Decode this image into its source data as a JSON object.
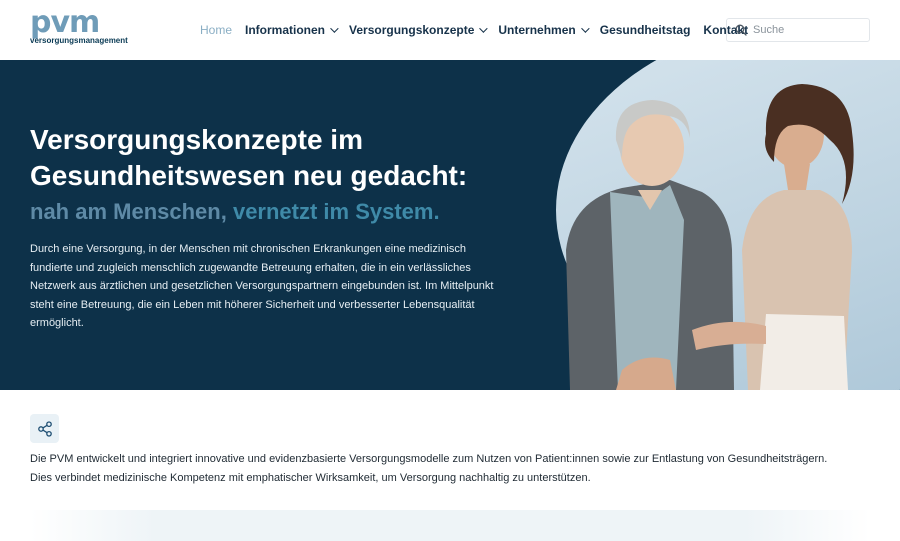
{
  "logo": {
    "main": "pvm",
    "sub": "versorgungsmanagement"
  },
  "nav": {
    "items": [
      {
        "label": "Home",
        "active": true,
        "dropdown": false
      },
      {
        "label": "Informationen",
        "active": false,
        "dropdown": true
      },
      {
        "label": "Versorgungskonzepte",
        "active": false,
        "dropdown": true
      },
      {
        "label": "Unternehmen",
        "active": false,
        "dropdown": true
      },
      {
        "label": "Gesundheitstag",
        "active": false,
        "dropdown": false
      },
      {
        "label": "Kontakt",
        "active": false,
        "dropdown": false
      }
    ]
  },
  "search": {
    "placeholder": "Suche",
    "icon": "search-icon"
  },
  "hero": {
    "title": "Versorgungskonzepte im Gesundheitswesen neu gedacht:",
    "subtitle_part1": "nah am Menschen,",
    "subtitle_part2": " vernetzt im System.",
    "text": "Durch eine Versorgung, in der Menschen mit chronischen Erkrankungen eine medizinisch fundierte und zugleich menschlich zugewandte Betreuung erhalten, die in ein verlässliches Netzwerk aus ärztlichen und gesetzlichen Versorgungspartnern eingebunden ist. Im Mittelpunkt steht eine Betreuung, die ein Leben mit höherer Sicherheit und verbesserter Lebensqualität ermöglicht."
  },
  "intro": {
    "share_icon": "share-icon",
    "line1": "Die PVM entwickelt und integriert innovative und evidenzbasierte Versorgungsmodelle zum Nutzen von Patient:innen sowie zur Entlastung von Gesundheitsträgern.",
    "line2": "Dies verbindet medizinische Kompetenz mit emphatischer Wirksamkeit, um Versorgung nachhaltig zu unterstützen."
  },
  "colors": {
    "hero_bg": "#0d3149",
    "accent": "#6f9cb8",
    "nav_text": "#17324a"
  }
}
